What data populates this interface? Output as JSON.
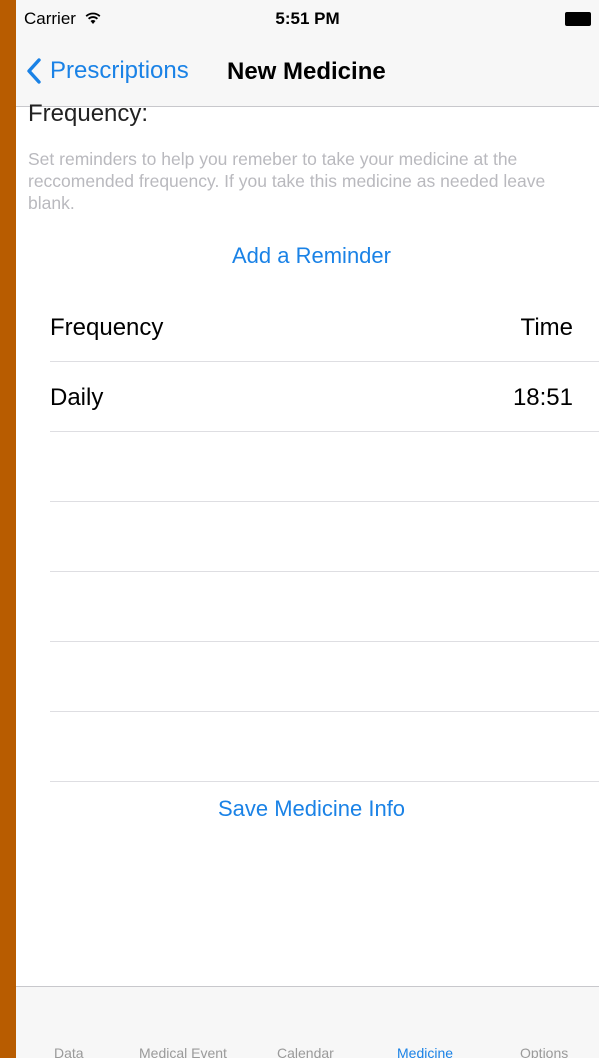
{
  "status_bar": {
    "carrier": "Carrier",
    "time": "5:51 PM"
  },
  "nav": {
    "back_label": "Prescriptions",
    "title": "New Medicine"
  },
  "section": {
    "heading": "Frequency:",
    "helper": "Set reminders to help you remeber to take your medicine at the reccomended frequency. If you take this medicine as needed leave blank."
  },
  "add_reminder_label": "Add a Reminder",
  "table": {
    "headers": [
      "Frequency",
      "Time"
    ],
    "rows": [
      {
        "frequency": "Daily",
        "time": "18:51"
      }
    ]
  },
  "save_label": "Save Medicine Info",
  "tabs": [
    {
      "label": "Data"
    },
    {
      "label": "Medical Event"
    },
    {
      "label": "Calendar"
    },
    {
      "label": "Medicine"
    },
    {
      "label": "Options"
    }
  ],
  "colors": {
    "accent": "#1a82e6",
    "frame": "#b85c00"
  }
}
